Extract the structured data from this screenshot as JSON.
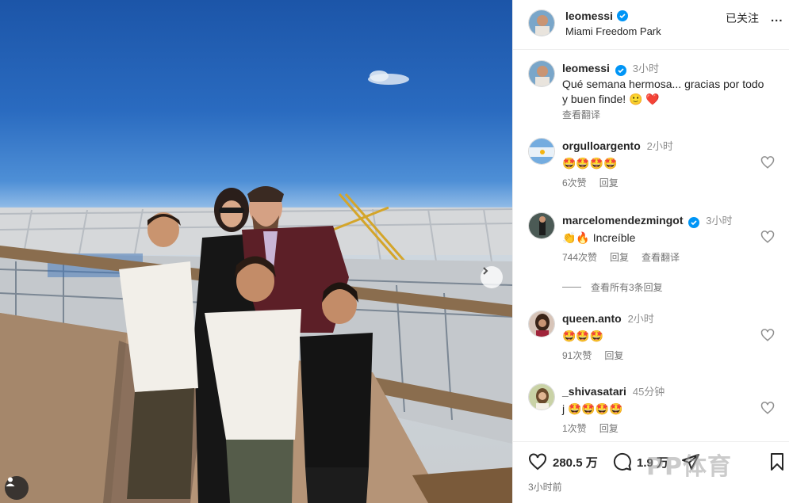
{
  "post": {
    "username": "leomessi",
    "location": "Miami Freedom Park",
    "follow_label": "已关注",
    "more_label": "..."
  },
  "caption": {
    "username": "leomessi",
    "time": "3小时",
    "text": "Qué semana hermosa... gracias por todo y buen finde! 🙂 ❤️",
    "translate_label": "查看翻译"
  },
  "comments": [
    {
      "username": "orgulloargento",
      "time": "2小时",
      "text": "🤩🤩🤩🤩",
      "likes": "6次赞",
      "reply": "回复",
      "translate": ""
    },
    {
      "username": "marcelomendezmingot",
      "time": "3小时",
      "text": "👏🔥 Increíble",
      "likes": "744次赞",
      "reply": "回复",
      "translate": "查看翻译",
      "view_replies": "查看所有3条回复"
    },
    {
      "username": "queen.anto",
      "time": "2小时",
      "text": "🤩🤩🤩",
      "likes": "91次赞",
      "reply": "回复",
      "translate": ""
    },
    {
      "username": "_shivasatari",
      "time": "45分钟",
      "text": "j 🤩🤩🤩🤩",
      "likes": "1次赞",
      "reply": "回复",
      "translate": ""
    }
  ],
  "actions": {
    "likes_count": "280.5 万",
    "comments_count": "1.9 万",
    "post_time": "3小时前",
    "watermark": "PP体育"
  },
  "colors": {
    "verified": "#0095f6",
    "sky": "#2a6bc0",
    "heart": "#ed4956"
  }
}
